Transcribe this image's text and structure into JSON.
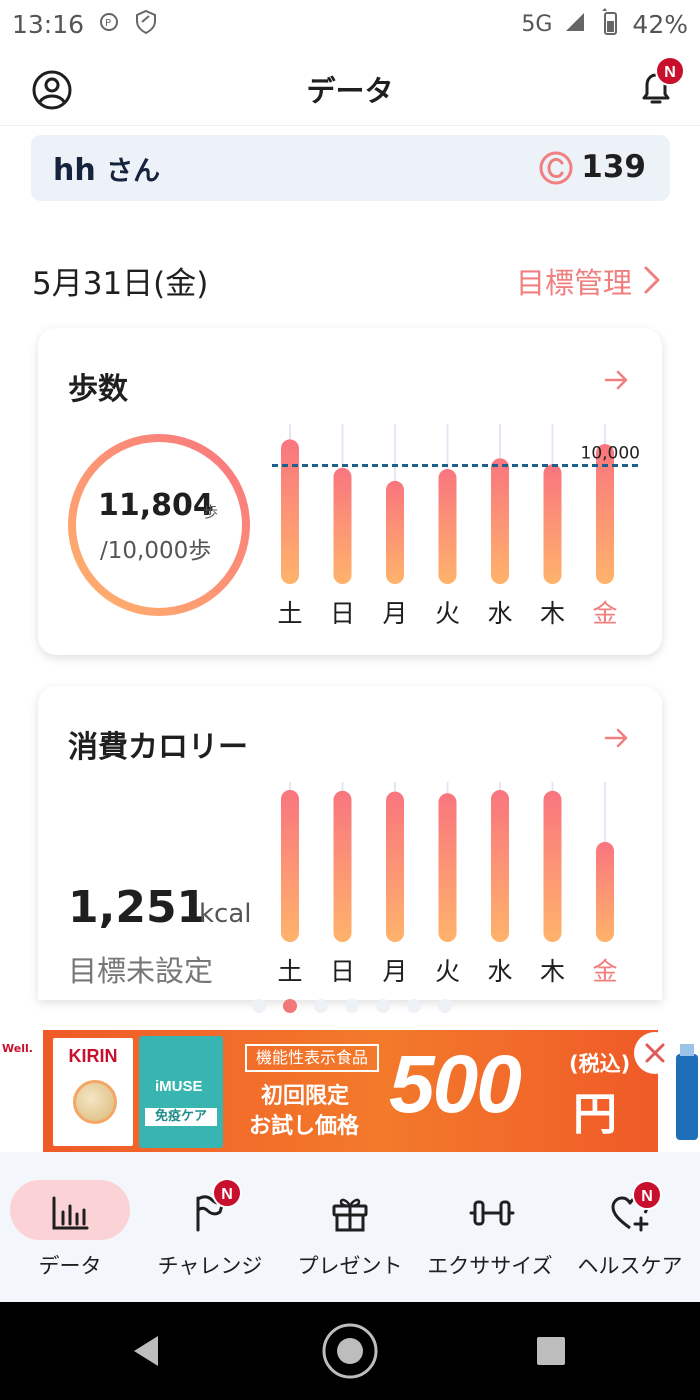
{
  "status_bar": {
    "time": "13:16",
    "network": "5G",
    "battery": "42%"
  },
  "header": {
    "title": "データ",
    "notification_badge": "N"
  },
  "user": {
    "name": "hh",
    "suffix": "さん",
    "points": "139"
  },
  "date_row": {
    "date": "5月31日(金)",
    "goal_link": "目標管理"
  },
  "steps_card": {
    "title": "歩数",
    "value": "11,804",
    "value_unit": "歩",
    "goal": "/10,000歩",
    "goal_line_label": "10,000",
    "progress": 1.0,
    "chart_data": {
      "type": "bar",
      "categories": [
        "土",
        "日",
        "月",
        "火",
        "水",
        "木",
        "金"
      ],
      "values": [
        12200,
        9800,
        8700,
        9700,
        10600,
        10100,
        11804
      ],
      "goal": 10000,
      "ylim": [
        0,
        13500
      ],
      "highlight_index": 6
    }
  },
  "calories_card": {
    "title": "消費カロリー",
    "value": "1,251",
    "unit": "kcal",
    "goal_text": "目標未設定",
    "chart_data": {
      "type": "bar",
      "categories": [
        "土",
        "日",
        "月",
        "火",
        "水",
        "木",
        "金"
      ],
      "values": [
        1900,
        1890,
        1880,
        1860,
        1900,
        1890,
        1251
      ],
      "ylim": [
        0,
        2000
      ],
      "highlight_index": 6
    }
  },
  "page_dots": {
    "count": 7,
    "active": 1
  },
  "ad": {
    "brand": "KIRIN",
    "left_text": "Well.",
    "product": "iMUSE",
    "product_sub": "免疫ケア",
    "tag": "機能性表示食品",
    "line1": "初回限定",
    "line2": "お試し価格",
    "price": "500",
    "currency": "円",
    "tax": "(税込)"
  },
  "bottom_nav": {
    "items": [
      {
        "label": "データ",
        "icon": "bar-chart-icon",
        "active": true,
        "badge": ""
      },
      {
        "label": "チャレンジ",
        "icon": "flag-icon",
        "active": false,
        "badge": "N"
      },
      {
        "label": "プレゼント",
        "icon": "gift-icon",
        "active": false,
        "badge": ""
      },
      {
        "label": "エクササイズ",
        "icon": "dumbbell-icon",
        "active": false,
        "badge": ""
      },
      {
        "label": "ヘルスケア",
        "icon": "heart-plus-icon",
        "active": false,
        "badge": "N"
      }
    ]
  },
  "colors": {
    "accent": "#f07f7f",
    "goal_line": "#1f5f8b",
    "bar_top": "#f9757f",
    "bar_bottom": "#ffb36b"
  }
}
